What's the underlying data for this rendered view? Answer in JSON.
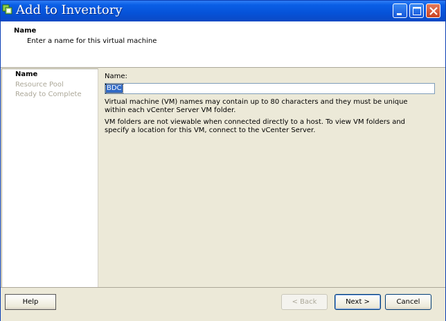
{
  "window": {
    "title": "Add to Inventory",
    "colors": {
      "titlebar": "#0652d8",
      "selection": "#316ac5",
      "panel": "#ece9d8"
    }
  },
  "header": {
    "title": "Name",
    "subtitle": "Enter a name for this virtual machine"
  },
  "steps": [
    {
      "label": "Name",
      "active": true
    },
    {
      "label": "Resource Pool",
      "active": false
    },
    {
      "label": "Ready to Complete",
      "active": false
    }
  ],
  "content": {
    "name_label": "Name:",
    "name_value": "BDC",
    "info1": "Virtual machine (VM) names may contain up to 80 characters and they must be unique within each vCenter Server VM folder.",
    "info2": "VM folders are not viewable when connected directly to a host. To view VM folders and specify a location for this VM, connect to the vCenter Server."
  },
  "footer": {
    "help_label": "Help",
    "back_label": "< Back",
    "next_label": "Next >",
    "cancel_label": "Cancel"
  }
}
